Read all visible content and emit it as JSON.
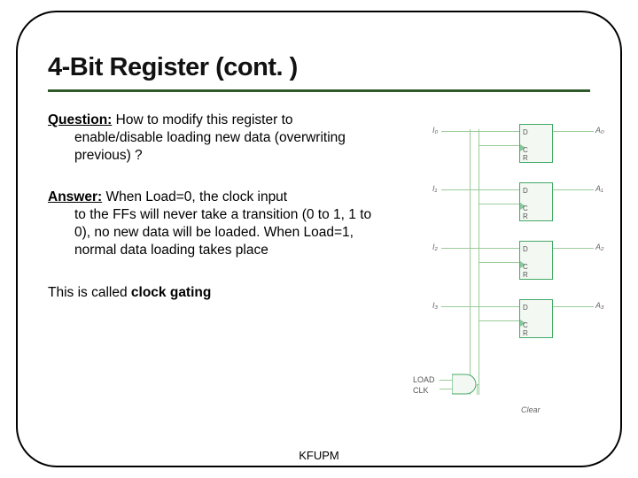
{
  "title": "4-Bit Register (cont. )",
  "question": {
    "label": "Question:",
    "first_tail": " How to modify this register to",
    "rest": "enable/disable loading new data (overwriting previous) ?"
  },
  "answer": {
    "label": "Answer:",
    "first_tail": " When Load=0, the clock input",
    "rest": "to the FFs will never take a transition (0 to 1, 1 to 0), no new data will be loaded. When Load=1, normal data loading takes place"
  },
  "closing": {
    "prefix": "This is called  ",
    "term": "clock gating"
  },
  "footer": "KFUPM",
  "diagram": {
    "inputs": [
      "I₀",
      "I₁",
      "I₂",
      "I₃"
    ],
    "outputs": [
      "A₀",
      "A₁",
      "A₂",
      "A₃"
    ],
    "ff_labels": {
      "d": "D",
      "c": "C",
      "r": "R"
    },
    "gate_inputs": [
      "LOAD",
      "CLK"
    ],
    "bottom_label": "Clear"
  }
}
